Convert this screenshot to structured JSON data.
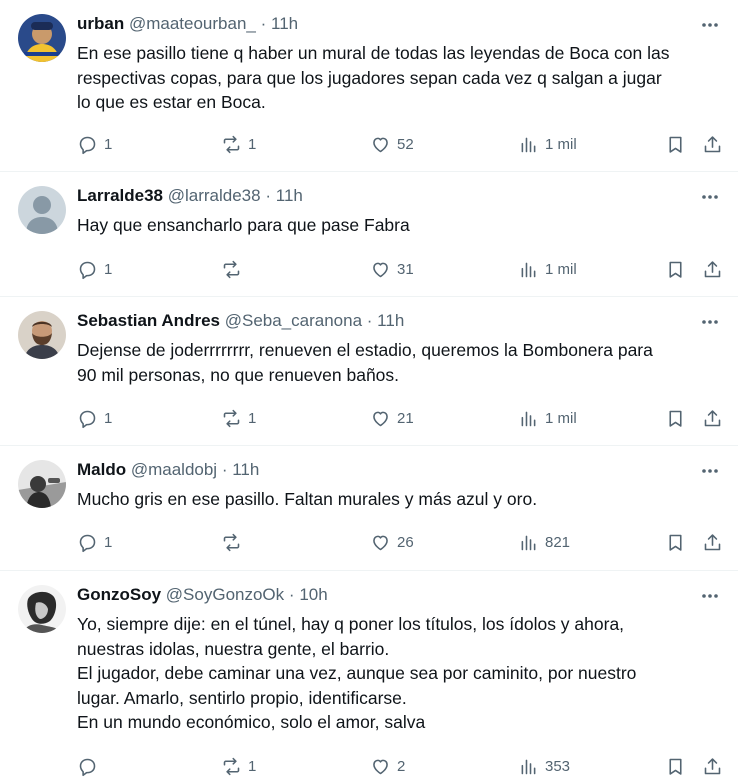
{
  "tweets": [
    {
      "name": "urban",
      "handle": "@maateourban_",
      "dot": "·",
      "time": "11h",
      "lines": [
        "En ese pasillo tiene q haber un mural de todas las leyendas de Boca con las",
        "respectivas copas, para que los jugadores sepan cada vez q salgan a jugar",
        "lo que es estar en Boca."
      ],
      "replies": "1",
      "reposts": "1",
      "likes": "52",
      "views": "1 mil",
      "avatar": "avatar-boca-player"
    },
    {
      "name": "Larralde38",
      "handle": "@larralde38",
      "dot": "·",
      "time": "11h",
      "lines": [
        "Hay que ensancharlo para que pase Fabra"
      ],
      "replies": "1",
      "reposts": "",
      "likes": "31",
      "views": "1 mil",
      "avatar": "default-avatar"
    },
    {
      "name": "Sebastian Andres",
      "handle": "@Seba_caranona",
      "dot": "·",
      "time": "11h",
      "lines": [
        "Dejense de joderrrrrrrr, renueven el estadio, queremos la Bombonera para",
        "90 mil personas, no que renueven baños."
      ],
      "replies": "1",
      "reposts": "1",
      "likes": "21",
      "views": "1 mil",
      "avatar": "avatar-bearded-man"
    },
    {
      "name": "Maldo",
      "handle": "@maaldobj",
      "dot": "·",
      "time": "11h",
      "lines": [
        "Mucho gris en ese pasillo. Faltan murales y más azul y oro."
      ],
      "replies": "1",
      "reposts": "",
      "likes": "26",
      "views": "821",
      "avatar": "avatar-bw-photo"
    },
    {
      "name": "GonzoSoy",
      "handle": "@SoyGonzoOk",
      "dot": "·",
      "time": "10h",
      "lines": [
        "Yo, siempre dije: en el túnel, hay q poner los títulos, los ídolos y ahora,",
        "nuestras idolas, nuestra gente, el barrio.",
        "El jugador, debe caminar una vez, aunque sea por caminito, por nuestro",
        "lugar. Amarlo, sentirlo propio, identificarse.",
        "En un mundo económico, solo el amor, salva"
      ],
      "replies": "",
      "reposts": "1",
      "likes": "2",
      "views": "353",
      "avatar": "avatar-bw-sketch"
    }
  ]
}
